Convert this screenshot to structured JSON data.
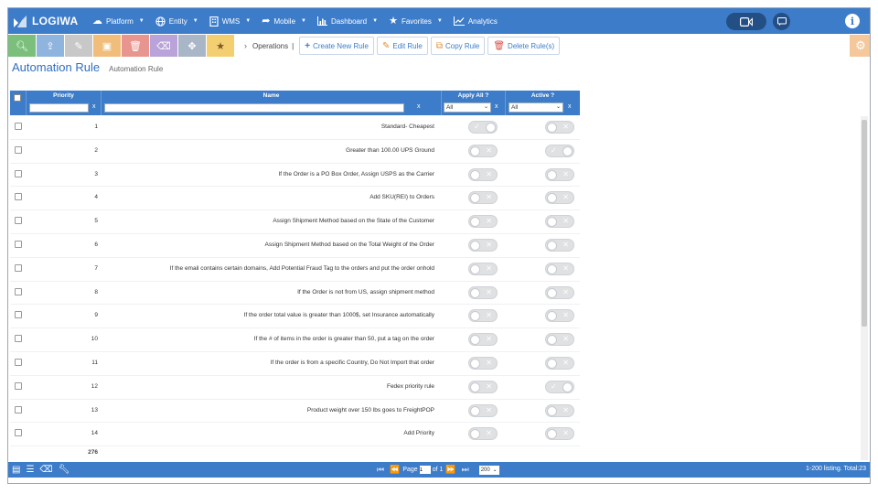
{
  "app": {
    "logo_text": "LOGIWA"
  },
  "nav": [
    {
      "label": "Platform",
      "icon": "cloud-icon",
      "caret": true
    },
    {
      "label": "Entity",
      "icon": "globe-icon",
      "caret": true
    },
    {
      "label": "WMS",
      "icon": "building-icon",
      "caret": true
    },
    {
      "label": "Mobile",
      "icon": "share-arrow-icon",
      "caret": true
    },
    {
      "label": "Dashboard",
      "icon": "bar-chart-icon",
      "caret": true
    },
    {
      "label": "Favorites",
      "icon": "star-icon",
      "caret": true
    },
    {
      "label": "Analytics",
      "icon": "line-chart-icon",
      "caret": false
    }
  ],
  "toolbar": {
    "breadcrumb": "Operations",
    "create_label": "Create New Rule",
    "edit_label": "Edit Rule",
    "copy_label": "Copy Rule",
    "delete_label": "Delete Rule(s)"
  },
  "colors": {
    "nav_bg": "#3d7cc9",
    "accent": "#2f6fc1",
    "search": "#7cbf7c",
    "upload": "#8fb5de",
    "edit": "#c8c8c8",
    "save": "#f0bd7a",
    "delete": "#e8948f",
    "erase": "#b9a3d8",
    "move": "#a9b6c8",
    "favorite": "#f3cf72"
  },
  "page": {
    "title": "Automation Rule",
    "subtitle": "Automation Rule"
  },
  "grid": {
    "columns": {
      "priority": "Priority",
      "name": "Name",
      "apply_all": "Apply All ?",
      "active": "Active ?"
    },
    "filters": {
      "apply_all": "All",
      "active": "All",
      "clear": "x"
    },
    "rows": [
      {
        "priority": "1",
        "name": "Standard- Cheapest",
        "apply_all": true,
        "active": false
      },
      {
        "priority": "2",
        "name": "Greater than 100.00 UPS Ground",
        "apply_all": false,
        "active": true
      },
      {
        "priority": "3",
        "name": "If the Order is a PO Box Order, Assign USPS as the Carrier",
        "apply_all": false,
        "active": false
      },
      {
        "priority": "4",
        "name": "Add SKU(REI) to Orders",
        "apply_all": false,
        "active": false
      },
      {
        "priority": "5",
        "name": "Assign Shipment Method based on the State of the Customer",
        "apply_all": false,
        "active": false
      },
      {
        "priority": "6",
        "name": "Assign Shipment Method based on the Total Weight of the Order",
        "apply_all": false,
        "active": false
      },
      {
        "priority": "7",
        "name": "If the email contains certain domains, Add Potential Fraud Tag to the orders and put the order onhold",
        "apply_all": false,
        "active": false
      },
      {
        "priority": "8",
        "name": "If the Order is not from US, assign shipment method",
        "apply_all": false,
        "active": false
      },
      {
        "priority": "9",
        "name": "If the order total value is greater than 1000$, set Insurance automatically",
        "apply_all": false,
        "active": false
      },
      {
        "priority": "10",
        "name": "If the # of items in the order is greater than 50, put a tag on the order",
        "apply_all": false,
        "active": false
      },
      {
        "priority": "11",
        "name": "If the order is from a specific Country, Do Not Import that order",
        "apply_all": false,
        "active": false
      },
      {
        "priority": "12",
        "name": "Fedex priority rule",
        "apply_all": false,
        "active": true
      },
      {
        "priority": "13",
        "name": "Product weight over 150 lbs goes to FreightPOP",
        "apply_all": false,
        "active": false
      },
      {
        "priority": "14",
        "name": "Add Priority",
        "apply_all": false,
        "active": false
      }
    ],
    "footer_total": "276"
  },
  "pager": {
    "page_label": "Page",
    "page_value": "1",
    "of_label": "of 1",
    "page_size": "200",
    "listing_text": "1-200 listing. Total:23"
  }
}
